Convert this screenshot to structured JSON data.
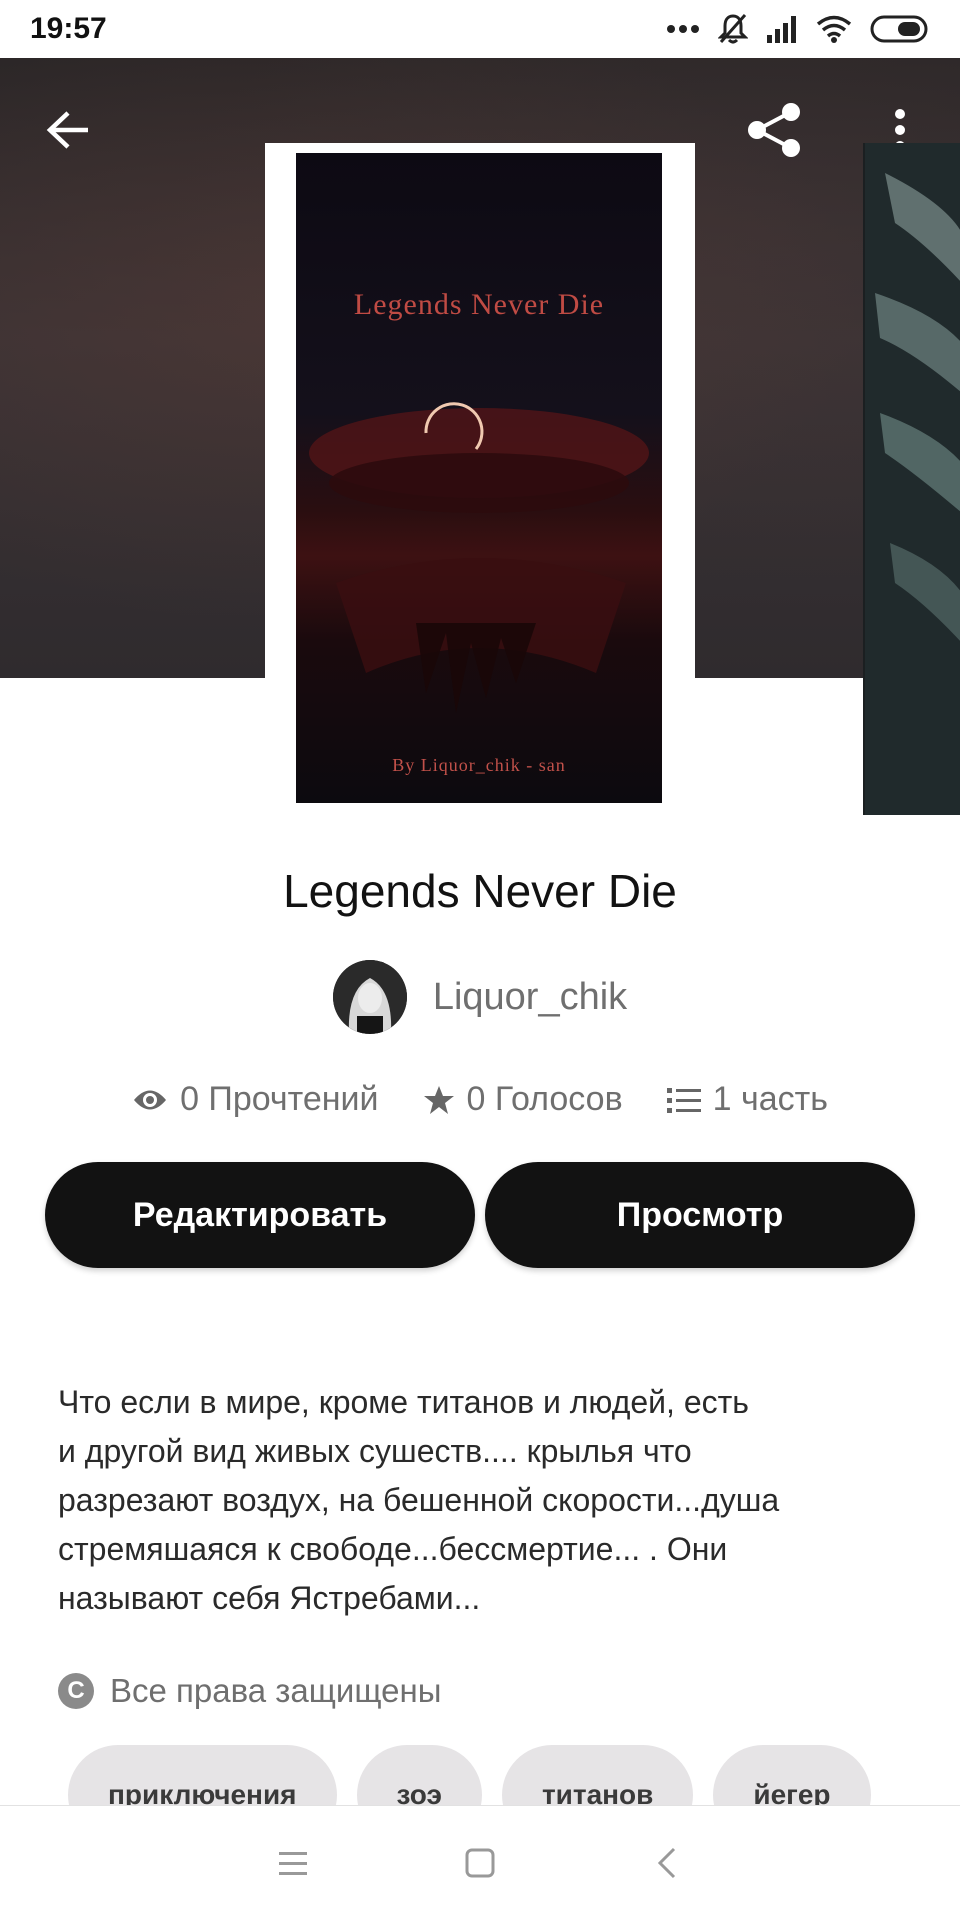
{
  "status_bar": {
    "time": "19:57",
    "icons": [
      "dots-icon",
      "bell-off-icon",
      "signal-icon",
      "wifi-icon",
      "battery-icon"
    ]
  },
  "header": {
    "back_icon": "back-arrow-icon",
    "share_icon": "share-icon",
    "menu_icon": "more-vertical-icon"
  },
  "cover": {
    "title": "Legends Never Die",
    "byline": "By Liquor_chik - san"
  },
  "story": {
    "title": "Legends Never Die",
    "author": "Liquor_chik"
  },
  "stats": {
    "reads": "0 Прочтений",
    "votes": "0 Голосов",
    "parts": "1 часть"
  },
  "actions": {
    "edit_label": "Редактировать",
    "view_label": "Просмотр"
  },
  "description": {
    "line1": "Что если в мире, кроме титанов и людей, есть",
    "line2": "и другой вид живых сушеств.... крылья что",
    "line3": "разрезают воздух, на бешенной скорости...душа",
    "line4": "стремяшаяся к свободе...бессмертие... . Они",
    "line5": "называют себя Ястребами..."
  },
  "copyright": {
    "icon_letter": "C",
    "label": "Все права защищены"
  },
  "tags": [
    "приключения",
    "зоэ",
    "титанов",
    "йегер"
  ],
  "colors": {
    "accent": "#121212",
    "button_text": "#ffffff",
    "muted_text": "#6f6f6f",
    "tag_bg": "#e6e4e6"
  }
}
